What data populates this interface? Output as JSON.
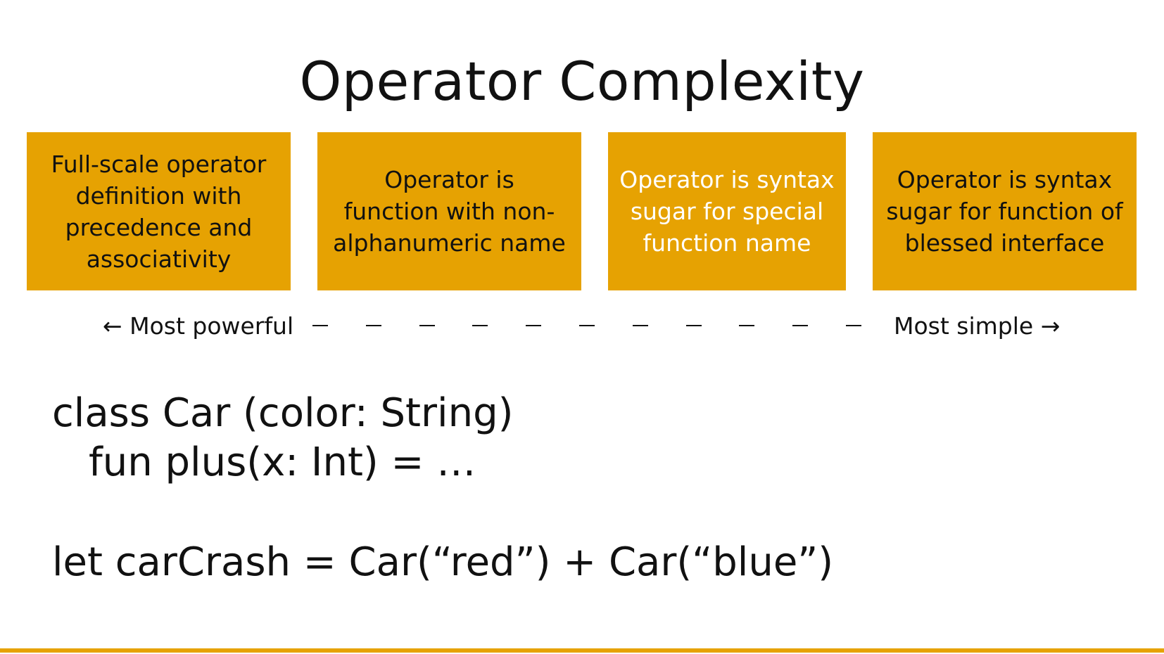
{
  "title": "Operator Complexity",
  "boxes": [
    {
      "text": "Full-scale operator\ndefinition with\nprecedence and\nassociativity"
    },
    {
      "text": "Operator is\nfunction with non-\nalphanumeric name"
    },
    {
      "text": "Operator is syntax\nsugar for special\nfunction name"
    },
    {
      "text": "Operator is syntax\nsugar for function of\nblessed interface"
    }
  ],
  "scale": {
    "left_label": "← Most powerful",
    "right_label": "Most simple →",
    "dash_count": 11
  },
  "code": {
    "line1": "class Car (color: String)",
    "line2": "fun plus(x: Int) = …",
    "line3": "let carCrash = Car(“red”) + Car(“blue”)"
  },
  "colors": {
    "accent": "#E6A202",
    "text": "#111111",
    "box3_text": "#ffffff"
  }
}
